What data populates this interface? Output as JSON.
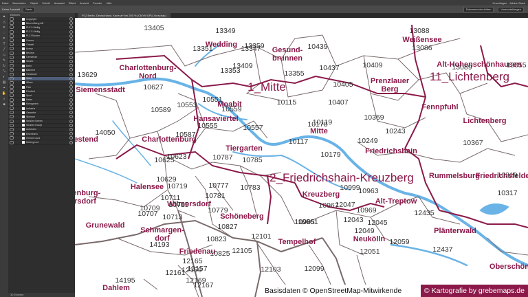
{
  "menubar": {
    "items": [
      "Datei",
      "Bearbeiten",
      "Objekt",
      "Schrift",
      "Auswahl",
      "Effekt",
      "Ansicht",
      "Fenster",
      "Hilfe"
    ],
    "right": [
      "Grundlagen",
      "Adobe Stock"
    ]
  },
  "controlbar": {
    "left": "Keine Auswahl",
    "dropdown1": "Basic",
    "dropdown2": "Dokument einrichten",
    "dropdown3": "Voreinstellungen"
  },
  "tab": {
    "title": "PLZ Berlin, Deutschland, Karte.ai* bei 200 % (CMYK/GPU-Vorschau)"
  },
  "layers": {
    "header": "Ebenen",
    "items": [
      "Copyright",
      "Beschriftung AB",
      "PLZ 3-Stellig",
      "PLZ 5-Stellig",
      "PLZ Flächen",
      "Grenze",
      "Ortsteil",
      "Kreise",
      "Bezirke",
      "Gemeinde",
      "Straße",
      "Bahn",
      "Bahnhof",
      "Gewässer",
      "Wald",
      "Wiese",
      "Park",
      "Friedhof",
      "Sport",
      "Hafen",
      "Kleingarten",
      "Industrie",
      "Gewerbe",
      "Wohnen",
      "Straßen Neben",
      "Straßen Haupt",
      "Autobahn",
      "Eisenbahn",
      "Grenze Land",
      "Hintergrund"
    ],
    "selected_index": 14,
    "footer": "30 Ebenen"
  },
  "map": {
    "districts": {
      "mitte": "1_Mitte",
      "lichtenberg": "11_Lichtenberg",
      "fk": "2_Friedrichshain-Kreuzberg"
    },
    "places": {
      "wedding": "Wedding",
      "gesund": "Gesund-\nbrunnen",
      "weissensee": "Weißensee",
      "alt_hohen": "Alt-Hohenschönhausen",
      "ch_nord": "Charlottenburg-\nNord",
      "siemens": "Siemensstadt",
      "prenz": "Prenzlauer\nBerg",
      "fennpfuhl": "Fennpfuhl",
      "lichtenberg": "Lichtenberg",
      "moabit": "Moabit",
      "hansa": "Hansaviertel",
      "charlottenburg": "Charlottenburg",
      "tiergarten": "Tiergarten",
      "mitte": "Mitte",
      "friedrichshain": "Friedrichshain",
      "westend": "Westend",
      "rummelsburg": "Rummelsburg",
      "friedrichsfelde": "Friedrichsfelde",
      "halensee": "Halensee",
      "kreuzberg": "Kreuzberg",
      "wilmersdorf": "Wilmersdorf",
      "alt_treptow": "Alt-Treptow",
      "grunewald": "Grunewald",
      "schoeneberg": "Schöneberg",
      "schmargendorf": "Schmargen-\ndorf",
      "neukoelln": "Neukölln",
      "plaenterwald": "Plänterwald",
      "tempelhof": "Tempelhof",
      "friedenau": "Friedenau",
      "oberschoene": "Oberschöne",
      "dahlem": "Dahlem",
      "wilmersdorf_left": "tenburg-\nrsdorf"
    },
    "postcodes": [
      "13405",
      "13349",
      "13088",
      "13351",
      "13359",
      "13086",
      "13347",
      "10439",
      "13089",
      "13409",
      "13353",
      "10437",
      "10409",
      "13055",
      "13629",
      "13355",
      "10405",
      "10627",
      "10115",
      "10407",
      "10589",
      "10553",
      "10551",
      "10559",
      "10555",
      "10119",
      "10369",
      "10557",
      "10178",
      "14050",
      "10587",
      "10117",
      "10249",
      "10243",
      "10179",
      "10367",
      "10785",
      "10787",
      "10623",
      "10625",
      "10629",
      "10319",
      "10719",
      "10777",
      "10963",
      "10999",
      "10783",
      "10317",
      "10711",
      "10715",
      "10781",
      "10969",
      "10961",
      "10967",
      "10709",
      "10779",
      "10827",
      "10965",
      "12047",
      "12435",
      "10707",
      "10713",
      "10823",
      "12043",
      "12045",
      "12049",
      "12101",
      "12051",
      "14193",
      "10825",
      "12059",
      "12437",
      "12157",
      "12105",
      "12099",
      "12103",
      "12161",
      "12159",
      "14195",
      "12169",
      "12165",
      "12167"
    ],
    "credit_left": "Basisdaten © OpenStreetMap-Mitwirkende",
    "credit_right": "© Kartografie by grebemaps.de"
  },
  "colors": {
    "district": "#8b1a4a",
    "water": "#69b3e7",
    "boundary": "#7a6a6a"
  }
}
